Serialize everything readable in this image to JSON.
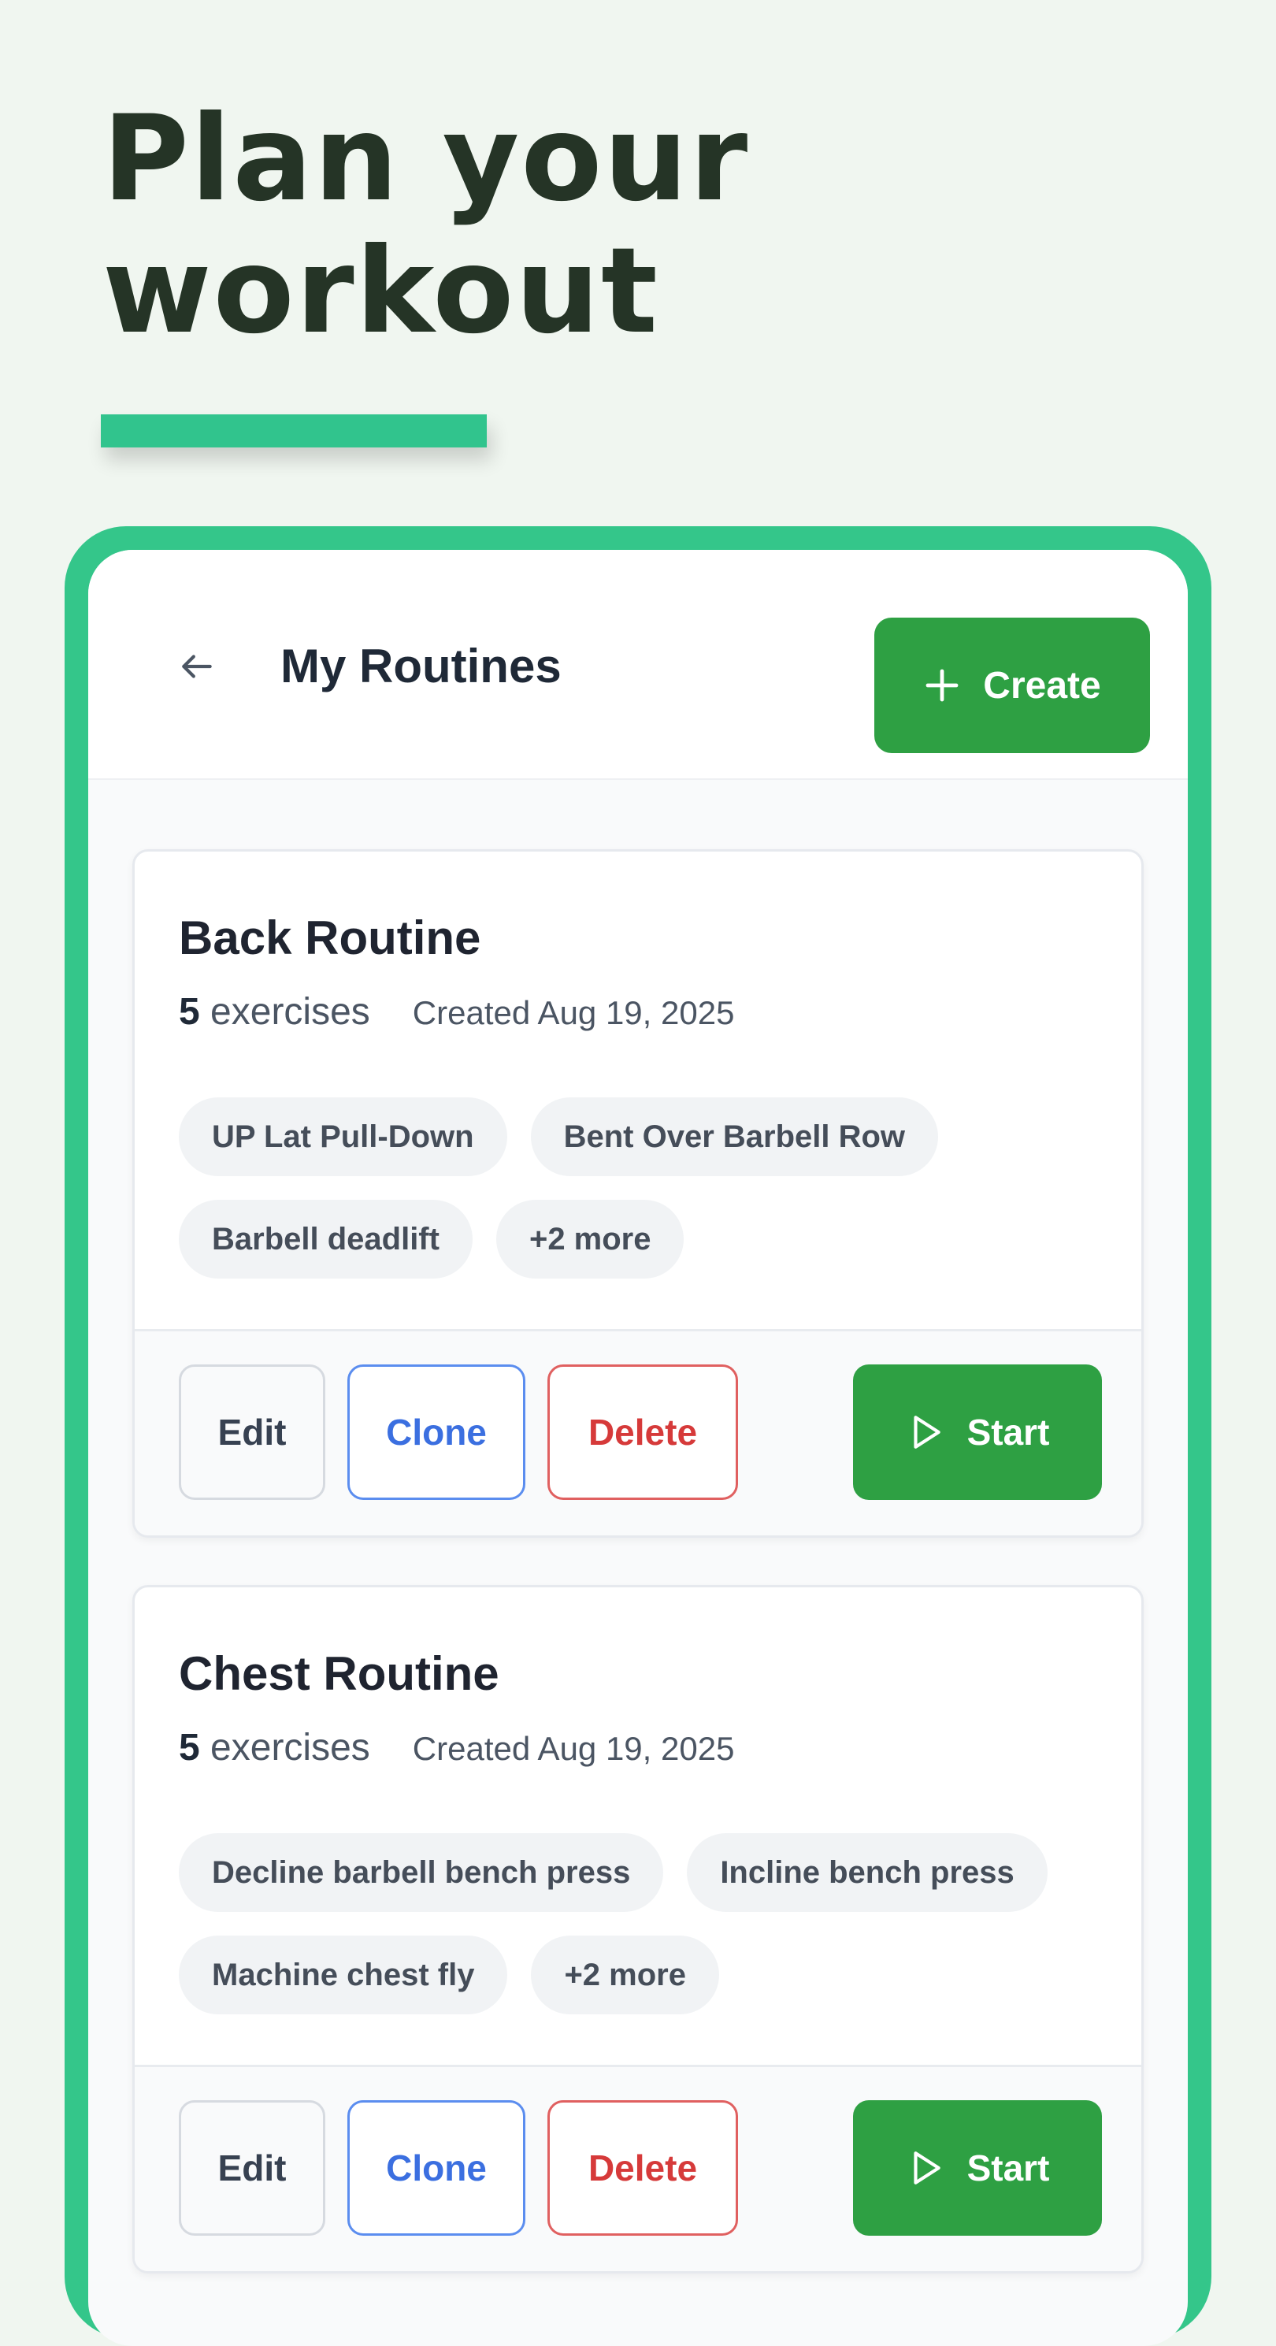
{
  "headline": {
    "line1": "Plan your",
    "line2": "workout"
  },
  "colors": {
    "accent": "#31c48d",
    "primary_button": "#2ea043",
    "clone": "#3b6fe0",
    "delete": "#d63a3a",
    "background": "#f0f6f0"
  },
  "header": {
    "back_icon": "arrow-left-icon",
    "title": "My Routines",
    "create_icon": "plus-icon",
    "create_label": "Create"
  },
  "routines": [
    {
      "name": "Back Routine",
      "exercise_count": "5",
      "exercise_word": "exercises",
      "created": "Created Aug 19, 2025",
      "tags": [
        "UP Lat Pull-Down",
        "Bent Over Barbell Row",
        "Barbell deadlift",
        "+2 more"
      ],
      "actions": {
        "edit": "Edit",
        "clone": "Clone",
        "delete": "Delete",
        "start": "Start",
        "start_icon": "play-icon"
      }
    },
    {
      "name": "Chest Routine",
      "exercise_count": "5",
      "exercise_word": "exercises",
      "created": "Created Aug 19, 2025",
      "tags": [
        "Decline barbell bench press",
        "Incline bench press",
        "Machine chest fly",
        "+2 more"
      ],
      "actions": {
        "edit": "Edit",
        "clone": "Clone",
        "delete": "Delete",
        "start": "Start",
        "start_icon": "play-icon"
      }
    }
  ]
}
